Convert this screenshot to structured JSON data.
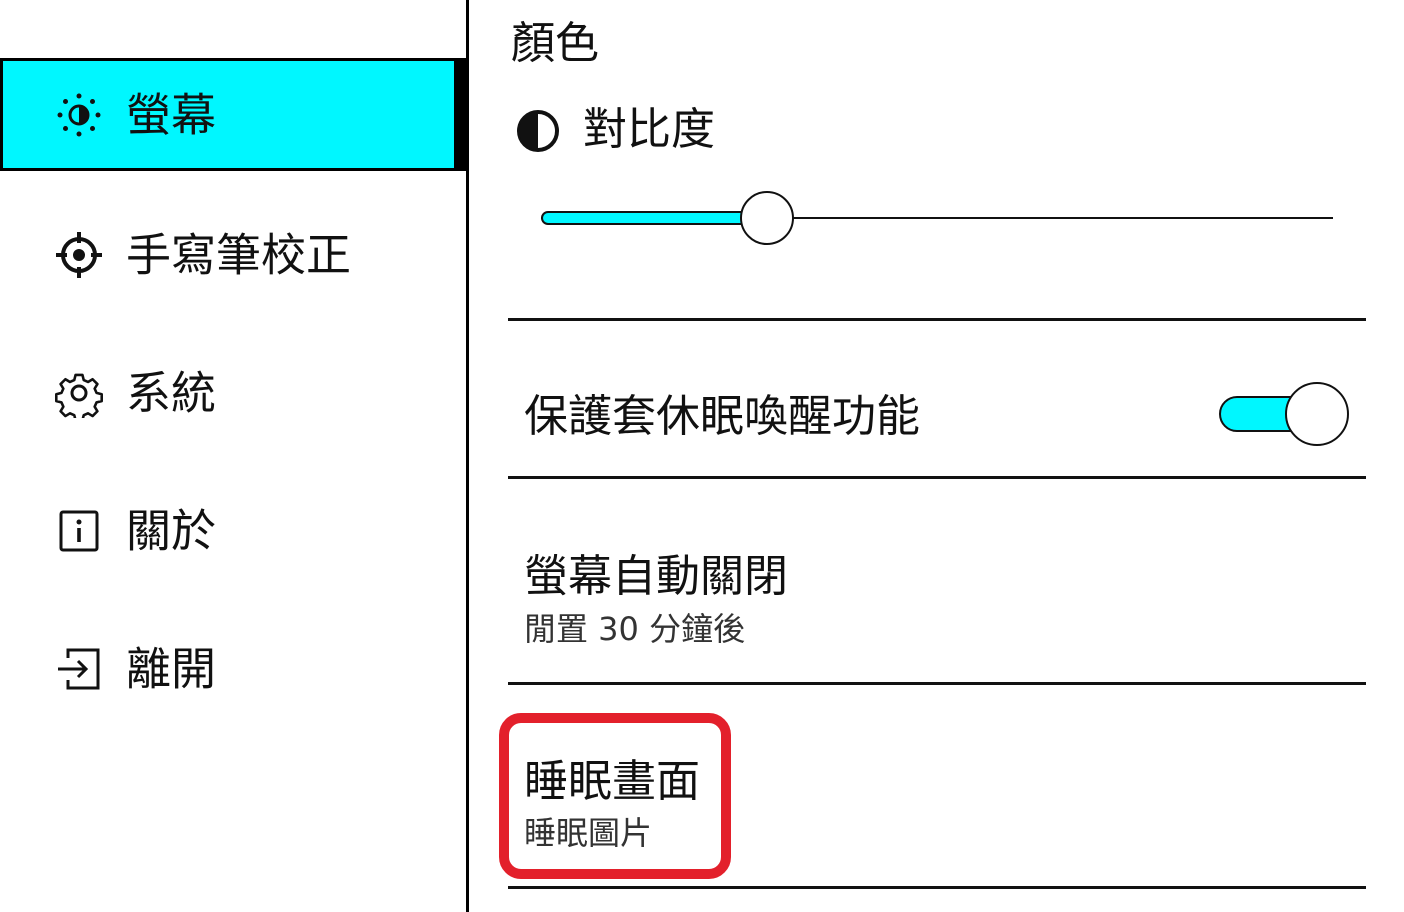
{
  "sidebar": {
    "items": [
      {
        "label": "螢幕",
        "icon": "brightness-icon",
        "active": true
      },
      {
        "label": "手寫筆校正",
        "icon": "crosshair-icon",
        "active": false
      },
      {
        "label": "系統",
        "icon": "gear-icon",
        "active": false
      },
      {
        "label": "關於",
        "icon": "info-icon",
        "active": false
      },
      {
        "label": "離開",
        "icon": "exit-icon",
        "active": false
      }
    ]
  },
  "main": {
    "section_title": "顏色",
    "contrast": {
      "label": "對比度",
      "icon": "contrast-icon",
      "value_fraction": 0.285
    },
    "cover_sleep": {
      "label": "保護套休眠喚醒功能",
      "enabled": true
    },
    "auto_off": {
      "title": "螢幕自動關閉",
      "subtitle": "閒置 30 分鐘後"
    },
    "sleep_screen": {
      "title": "睡眠畫面",
      "subtitle": "睡眠圖片"
    }
  },
  "colors": {
    "accent": "#00f7ff",
    "highlight": "#e3202b",
    "foreground": "#111111",
    "background": "#ffffff"
  }
}
